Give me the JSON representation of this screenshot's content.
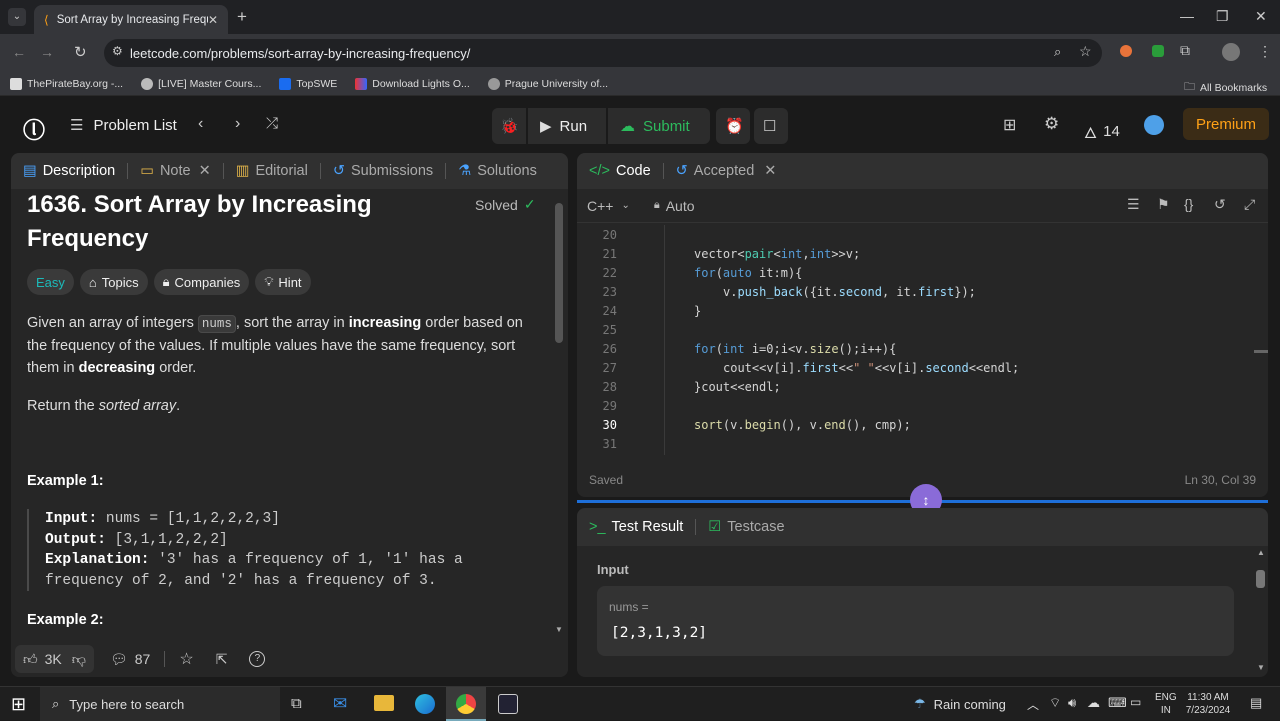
{
  "browser": {
    "tab_title": "Sort Array by Increasing Freque",
    "url": "leetcode.com/problems/sort-array-by-increasing-frequency/",
    "bookmarks": [
      "ThePirateBay.org -...",
      "[LIVE] Master Cours...",
      "TopSWE",
      "Download Lights O...",
      "Prague University of..."
    ],
    "all_bookmarks": "All Bookmarks"
  },
  "nav": {
    "problem_list": "Problem List",
    "run": "Run",
    "submit": "Submit",
    "streak": "14",
    "premium": "Premium"
  },
  "left_tabs": {
    "description": "Description",
    "note": "Note",
    "editorial": "Editorial",
    "submissions": "Submissions",
    "solutions": "Solutions"
  },
  "problem": {
    "title_line1": "1636. Sort Array by Increasing",
    "title_line2": "Frequency",
    "solved": "Solved",
    "difficulty": "Easy",
    "topics": "Topics",
    "companies": "Companies",
    "hint": "Hint",
    "p1a": "Given an array of integers ",
    "p1code": "nums",
    "p1b": ", sort the array in ",
    "p1c": "increasing",
    "p1d": " order based on the frequency of the values. If multiple values have the same frequency, sort them in ",
    "p1e": "decreasing",
    "p1f": " order.",
    "p2a": "Return the ",
    "p2b": "sorted array",
    "p2c": ".",
    "ex1": "Example 1:",
    "ex1_input_label": "Input:",
    "ex1_input": " nums = [1,1,2,2,2,3]",
    "ex1_output_label": "Output:",
    "ex1_output": " [3,1,1,2,2,2]",
    "ex1_expl_label": "Explanation:",
    "ex1_expl1": " '3' has a frequency of 1, '1' has a",
    "ex1_expl2": "frequency of 2, and '2' has a frequency of 3.",
    "ex2": "Example 2:"
  },
  "footer": {
    "likes": "3K",
    "comments": "87"
  },
  "code_panel": {
    "tab_code": "Code",
    "tab_accepted": "Accepted",
    "language": "C++",
    "mode": "Auto",
    "saved": "Saved",
    "cursor": "Ln 30, Col 39",
    "line_numbers": [
      "20",
      "21",
      "22",
      "23",
      "24",
      "25",
      "26",
      "27",
      "28",
      "29",
      "30",
      "31"
    ]
  },
  "result": {
    "tab_result": "Test Result",
    "tab_testcase": "Testcase",
    "input_label": "Input",
    "var_label": "nums =",
    "var_value": "[2,3,1,3,2]"
  },
  "taskbar": {
    "search": "Type here to search",
    "weather": "Rain coming",
    "lang1": "ENG",
    "lang2": "IN",
    "time": "11:30 AM",
    "date": "7/23/2024"
  }
}
